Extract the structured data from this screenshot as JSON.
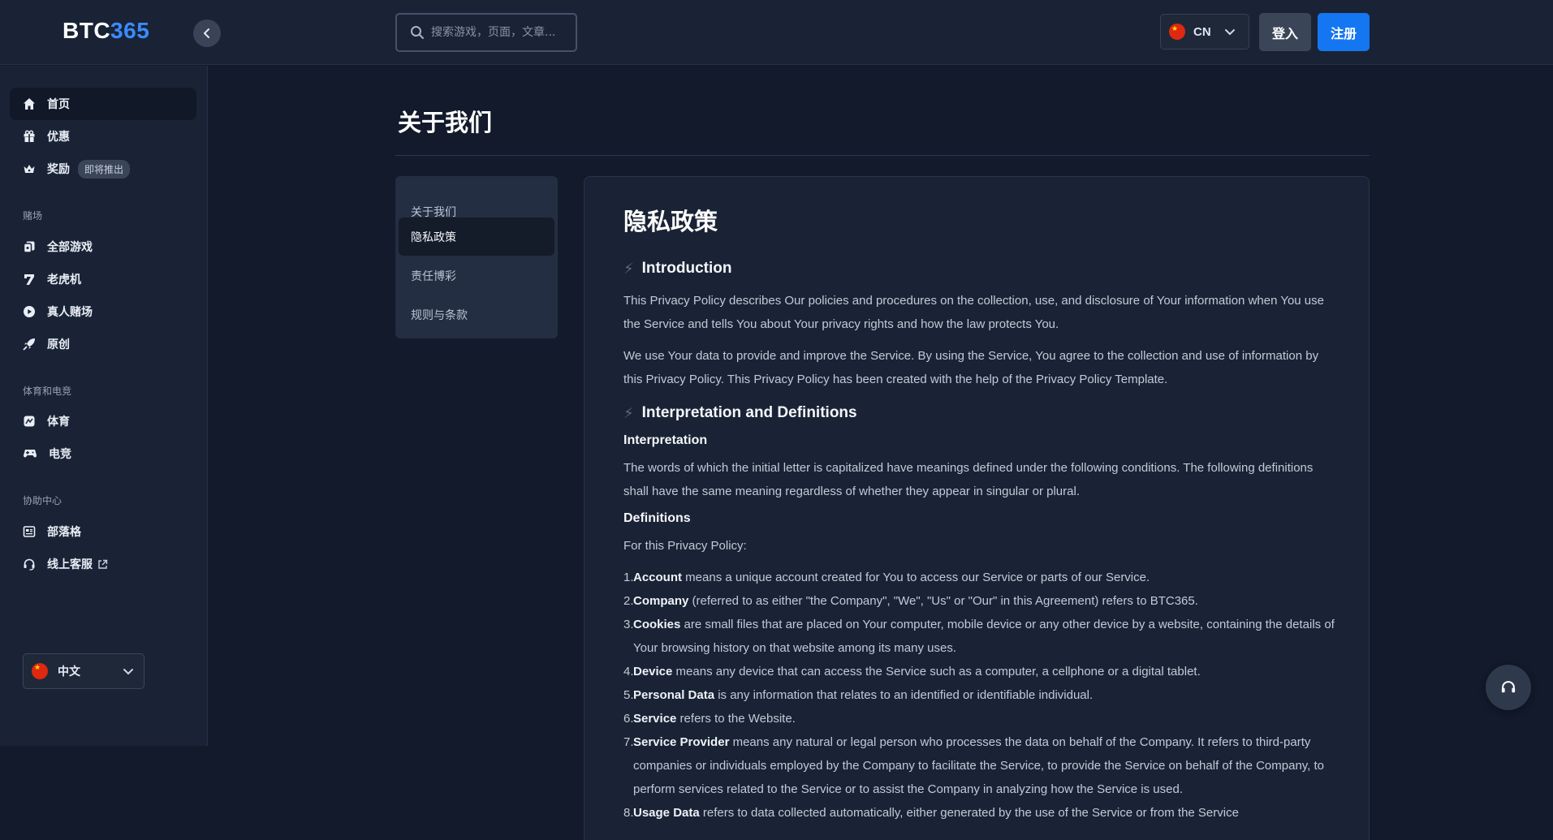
{
  "header": {
    "logo_main": "BTC",
    "logo_accent": "365",
    "search_placeholder": "搜索游戏，页面，文章...",
    "lang_code": "CN",
    "login_label": "登入",
    "register_label": "注册"
  },
  "sidebar": {
    "main_items": [
      {
        "label": "首页",
        "icon": "home-icon"
      },
      {
        "label": "优惠",
        "icon": "gift-icon"
      },
      {
        "label": "奖励",
        "icon": "crown-icon",
        "badge": "即将推出"
      }
    ],
    "casino_label": "赌场",
    "casino_items": [
      {
        "label": "全部游戏",
        "icon": "cards-icon"
      },
      {
        "label": "老虎机",
        "icon": "slot-seven-icon"
      },
      {
        "label": "真人赌场",
        "icon": "play-icon"
      },
      {
        "label": "原创",
        "icon": "rocket-icon"
      }
    ],
    "sports_label": "体育和电竞",
    "sports_items": [
      {
        "label": "体育",
        "icon": "sports-icon"
      },
      {
        "label": "电竞",
        "icon": "gamepad-icon"
      }
    ],
    "help_label": "协助中心",
    "help_items": [
      {
        "label": "部落格",
        "icon": "blog-icon"
      },
      {
        "label": "线上客服",
        "icon": "headset-icon"
      }
    ],
    "language": "中文"
  },
  "main": {
    "page_title": "关于我们",
    "tabs": [
      "关于我们",
      "隐私政策",
      "责任博彩",
      "规则与条款"
    ],
    "active_tab": 1,
    "article": {
      "title": "隐私政策",
      "intro_heading": "Introduction",
      "intro_p1": "This Privacy Policy describes Our policies and procedures on the collection, use, and disclosure of Your information when You use the Service and tells You about Your privacy rights and how the law protects You.",
      "intro_p2": "We use Your data to provide and improve the Service. By using the Service, You agree to the collection and use of information by this Privacy Policy. This Privacy Policy has been created with the help of the Privacy Policy Template.",
      "interp_heading": "Interpretation and Definitions",
      "interp_sub": "Interpretation",
      "interp_p": "The words of which the initial letter is capitalized have meanings defined under the following conditions. The following definitions shall have the same meaning regardless of whether they appear in singular or plural.",
      "defs_sub": "Definitions",
      "defs_intro": "For this Privacy Policy:",
      "definitions": [
        {
          "term": "Account",
          "text": " means a unique account created for You to access our Service or parts of our Service."
        },
        {
          "term": "Company",
          "text": " (referred to as either \"the Company\", \"We\", \"Us\" or \"Our\" in this Agreement) refers to BTC365."
        },
        {
          "term": "Cookies",
          "text": " are small files that are placed on Your computer, mobile device or any other device by a website, containing the details of Your browsing history on that website among its many uses."
        },
        {
          "term": "Device",
          "text": " means any device that can access the Service such as a computer, a cellphone or a digital tablet."
        },
        {
          "term": "Personal Data",
          "text": " is any information that relates to an identified or identifiable individual."
        },
        {
          "term": "Service",
          "text": " refers to the Website."
        },
        {
          "term": "Service Provider",
          "text": " means any natural or legal person who processes the data on behalf of the Company. It refers to third-party companies or individuals employed by the Company to facilitate the Service, to provide the Service on behalf of the Company, to perform services related to the Service or to assist the Company in analyzing how the Service is used."
        },
        {
          "term": "Usage Data",
          "text": " refers to data collected automatically, either generated by the use of the Service or from the Service"
        }
      ]
    }
  },
  "colors": {
    "bg": "#121a2b",
    "panel": "#1a2335",
    "accent": "#1576f1",
    "logo_accent": "#3b8bff"
  }
}
